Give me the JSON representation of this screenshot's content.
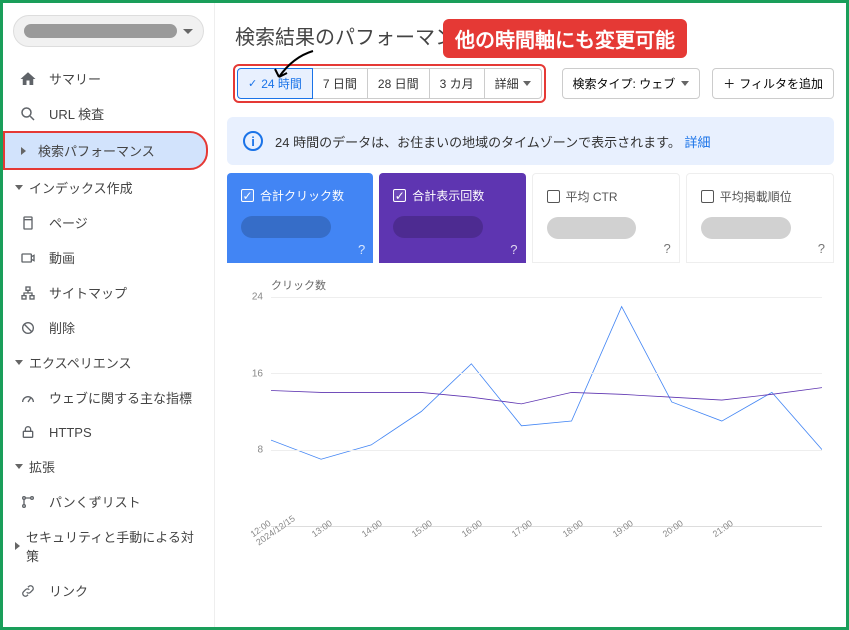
{
  "sidebar": {
    "summary": "サマリー",
    "url_inspect": "URL 検査",
    "search_perf": "検索パフォーマンス",
    "indexing": "インデックス作成",
    "pages": "ページ",
    "video": "動画",
    "sitemap": "サイトマップ",
    "removals": "削除",
    "experience": "エクスペリエンス",
    "core_web": "ウェブに関する主な指標",
    "https": "HTTPS",
    "enhancements": "拡張",
    "breadcrumbs": "パンくずリスト",
    "security": "セキュリティと手動による対策",
    "links": "リンク"
  },
  "header": {
    "title": "検索結果のパフォーマンス",
    "annotation": "他の時間軸にも変更可能"
  },
  "time_filters": {
    "t24h": "24 時間",
    "t7d": "7 日間",
    "t28d": "28 日間",
    "t3m": "3 カ月",
    "detail": "詳細"
  },
  "toolbar": {
    "search_type": "検索タイプ: ウェブ",
    "add_filter": "フィルタを追加"
  },
  "notice": {
    "text": "24 時間のデータは、お住まいの地域のタイムゾーンで表示されます。",
    "link": "詳細"
  },
  "metrics": {
    "clicks": "合計クリック数",
    "impressions": "合計表示回数",
    "ctr": "平均 CTR",
    "position": "平均掲載順位"
  },
  "chart_data": {
    "type": "line",
    "title": "クリック数",
    "ylim": [
      0,
      24
    ],
    "yticks": [
      24,
      16,
      8
    ],
    "categories": [
      "12:00\n2024/12/15",
      "13:00",
      "14:00",
      "15:00",
      "16:00",
      "17:00",
      "18:00",
      "19:00",
      "20:00",
      "21:00"
    ],
    "series": [
      {
        "name": "clicks",
        "color": "#4285f4",
        "values": [
          9,
          7,
          8.5,
          12,
          17,
          10.5,
          11,
          23,
          13,
          11,
          14,
          8
        ]
      },
      {
        "name": "impressions",
        "color": "#5e35b1",
        "values": [
          14.2,
          14,
          14,
          14,
          13.5,
          12.8,
          14,
          13.8,
          13.5,
          13.2,
          13.8,
          14.5
        ]
      }
    ]
  }
}
